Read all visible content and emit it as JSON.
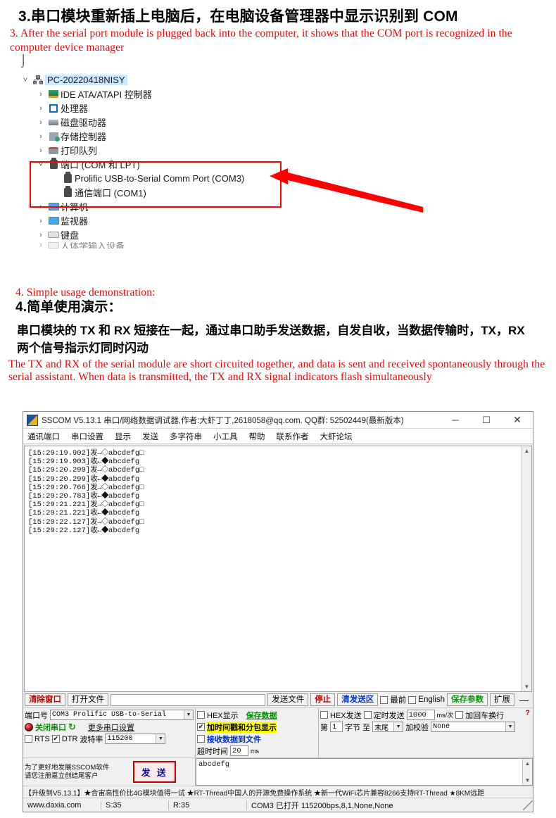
{
  "doc": {
    "step3_cn": "3.串口模块重新插上电脑后，在电脑设备管理器中显示识别到 COM",
    "step3_en": "3. After the serial port module is plugged back into the computer, it shows that the COM port is recognized in the computer device manager",
    "pilcrow": "↵",
    "step4_en": "4. Simple usage demonstration:",
    "step4_cn": "4.简单使用演示：",
    "body_cn": "串口模块的 TX 和 RX 短接在一起，通过串口助手发送数据，自发自收，当数据传输时，TX，RX 两个信号指示灯同时闪动",
    "body_en": "The TX and RX of the serial module are short circuited together, and data is sent and received spontaneously through the serial assistant. When data is transmitted, the TX and RX signal indicators flash simultaneously"
  },
  "device_tree": {
    "root": "PC-20220418NISY",
    "nodes": [
      {
        "label": "IDE ATA/ATAPI 控制器",
        "icon": "ide-controller-icon",
        "expandable": true,
        "level": 1
      },
      {
        "label": "处理器",
        "icon": "processor-icon",
        "expandable": true,
        "level": 1
      },
      {
        "label": "磁盘驱动器",
        "icon": "disk-drive-icon",
        "expandable": true,
        "level": 1
      },
      {
        "label": "存储控制器",
        "icon": "storage-controller-icon",
        "expandable": true,
        "level": 1
      },
      {
        "label": "打印队列",
        "icon": "print-queue-icon",
        "expandable": true,
        "level": 1
      },
      {
        "label": "端口 (COM 和 LPT)",
        "icon": "port-icon",
        "expandable": true,
        "expanded": true,
        "level": 1
      },
      {
        "label": "Prolific USB-to-Serial Comm Port (COM3)",
        "icon": "port-icon",
        "expandable": false,
        "level": 2
      },
      {
        "label": "通信端口 (COM1)",
        "icon": "port-icon",
        "expandable": false,
        "level": 2
      },
      {
        "label": "计算机",
        "icon": "computer-icon",
        "expandable": true,
        "level": 1
      },
      {
        "label": "监视器",
        "icon": "monitor-icon",
        "expandable": true,
        "level": 1
      },
      {
        "label": "键盘",
        "icon": "keyboard-icon",
        "expandable": true,
        "level": 1
      },
      {
        "label": "人体学输入设备",
        "icon": "hid-icon",
        "expandable": true,
        "level": 1
      }
    ],
    "highlight_color": "#ff0000",
    "annotation": "red-box-and-arrow-pointing-to-com3"
  },
  "sscom": {
    "title": "SSCOM V5.13.1 串口/网络数据调试器,作者:大虾丁丁,2618058@qq.com. QQ群: 52502449(最新版本)",
    "window_buttons": {
      "minimize": "─",
      "maximize": "☐",
      "close": "✕"
    },
    "menu": [
      "通讯端口",
      "串口设置",
      "显示",
      "发送",
      "多字符串",
      "小工具",
      "帮助",
      "联系作者",
      "大虾论坛"
    ],
    "log_lines": [
      {
        "time": "[15:29:19.902]",
        "dir": "发→◇",
        "text": "abcdefg□"
      },
      {
        "time": "[15:29:19.903]",
        "dir": "收←◆",
        "text": "abcdefg"
      },
      {
        "time": "[15:29:20.299]",
        "dir": "发→◇",
        "text": "abcdefg□"
      },
      {
        "time": "[15:29:20.299]",
        "dir": "收←◆",
        "text": "abcdefg"
      },
      {
        "time": "[15:29:20.766]",
        "dir": "发→◇",
        "text": "abcdefg□"
      },
      {
        "time": "[15:29:20.783]",
        "dir": "收←◆",
        "text": "abcdefg"
      },
      {
        "time": "[15:29:21.221]",
        "dir": "发→◇",
        "text": "abcdefg□"
      },
      {
        "time": "[15:29:21.221]",
        "dir": "收←◆",
        "text": "abcdefg"
      },
      {
        "time": "[15:29:22.127]",
        "dir": "发→◇",
        "text": "abcdefg□"
      },
      {
        "time": "[15:29:22.127]",
        "dir": "收←◆",
        "text": "abcdefg"
      }
    ],
    "toolbar": {
      "clear_window": "清除窗口",
      "open_file": "打开文件",
      "file_path_value": "",
      "send_file": "发送文件",
      "stop": "停止",
      "clear_send": "清发送区",
      "topmost": "最前",
      "english": "English",
      "save_params": "保存参数",
      "expand": "扩展",
      "minus": "—"
    },
    "config": {
      "port_label": "端口号",
      "port_value": "COM3 Prolific USB-to-Serial",
      "close_port_button": "关闭串口",
      "refresh_icon": "refresh-icon",
      "more_settings": "更多串口设置",
      "rts_label": "RTS",
      "rts_checked": false,
      "dtr_label": "DTR",
      "dtr_checked": true,
      "baud_label": "波特率",
      "baud_value": "115200",
      "hex_show": "HEX显示",
      "hex_show_checked": false,
      "save_data": "保存数据",
      "recv_to_file": "接收数据到文件",
      "recv_to_file_checked": false,
      "timestamp_show": "加时间戳和分包显示",
      "timestamp_checked": true,
      "timeout_label": "超时时间",
      "timeout_value": "20",
      "timeout_unit": "ms",
      "hex_send": "HEX发送",
      "hex_send_checked": false,
      "timed_send": "定时发送",
      "timed_send_checked": false,
      "interval_value": "1000",
      "interval_unit": "ms/次",
      "crlf_label": "加回车换行",
      "crlf_checked": false,
      "byte_from_label": "第",
      "byte_from_value": "1",
      "byte_mid_label": "字节 至",
      "byte_to_value": "末尾",
      "checksum_label": "加校验",
      "checksum_value": "None"
    },
    "send": {
      "promo_line1": "为了更好地发展SSCOM软件",
      "promo_line2": "请您注册嘉立创结尾客户",
      "send_button": "发 送",
      "send_text": "abcdefg"
    },
    "ad_bar": "【升级到V5.13.1】★合宙高性价比4G模块值得一试 ★RT-Thread中国人的开源免费操作系统 ★新一代WiFi芯片兼容8266支持RT-Thread ★8KM远距",
    "status": {
      "site": "www.daxia.com",
      "sent": "S:35",
      "received": "R:35",
      "connection": "COM3 已打开  115200bps,8,1,None,None"
    }
  }
}
